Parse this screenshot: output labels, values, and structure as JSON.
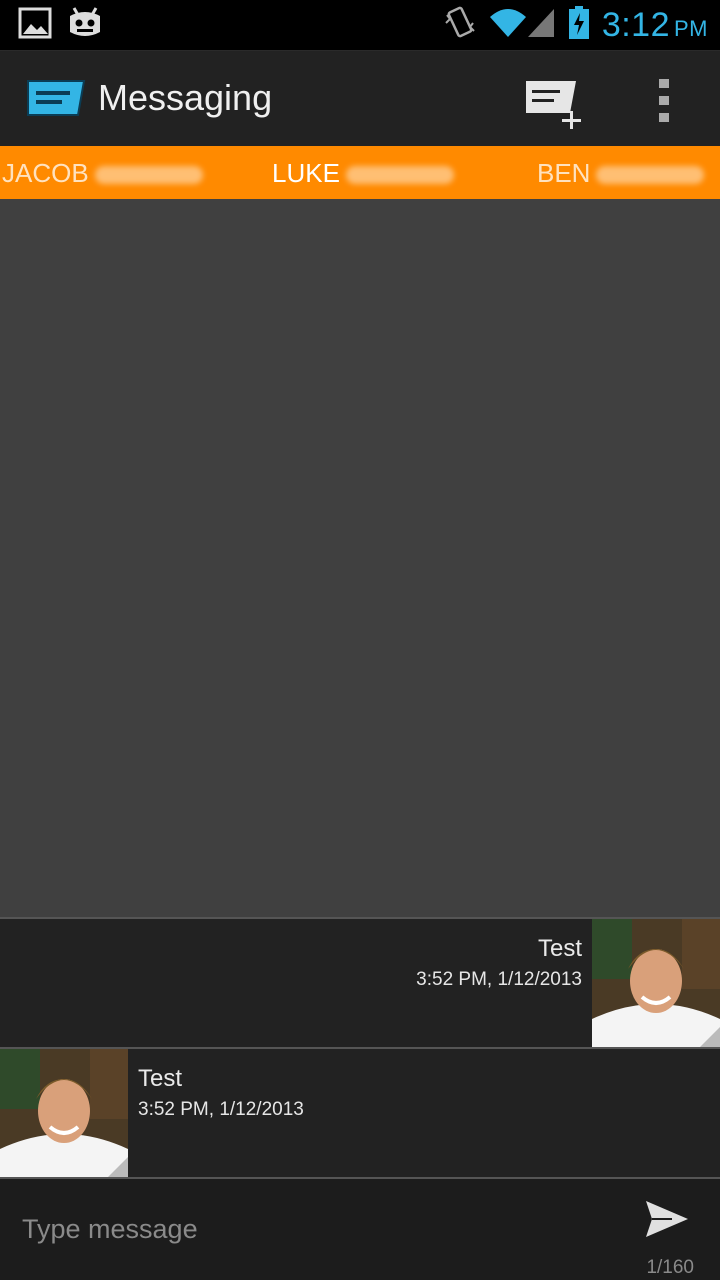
{
  "status_bar": {
    "time": "3:12",
    "ampm": "PM",
    "icons": [
      "gallery-notification-icon",
      "cyanogenmod-icon",
      "vibrate-icon",
      "wifi-icon",
      "signal-icon",
      "battery-charging-icon"
    ],
    "accent_color": "#33b5e5"
  },
  "action_bar": {
    "title": "Messaging",
    "icons": [
      "messaging-app-icon",
      "new-message-icon",
      "overflow-menu-icon"
    ]
  },
  "tabs": [
    {
      "label": "JACOB",
      "active": false
    },
    {
      "label": "LUKE",
      "active": true
    },
    {
      "label": "BEN",
      "active": false
    }
  ],
  "tab_color": "#ff8a00",
  "messages": [
    {
      "text": "Test",
      "time": "3:52 PM, 1/12/2013",
      "direction": "outgoing"
    },
    {
      "text": "Test",
      "time": "3:52 PM, 1/12/2013",
      "direction": "incoming"
    }
  ],
  "compose": {
    "placeholder": "Type message",
    "char_count": "1/160"
  }
}
